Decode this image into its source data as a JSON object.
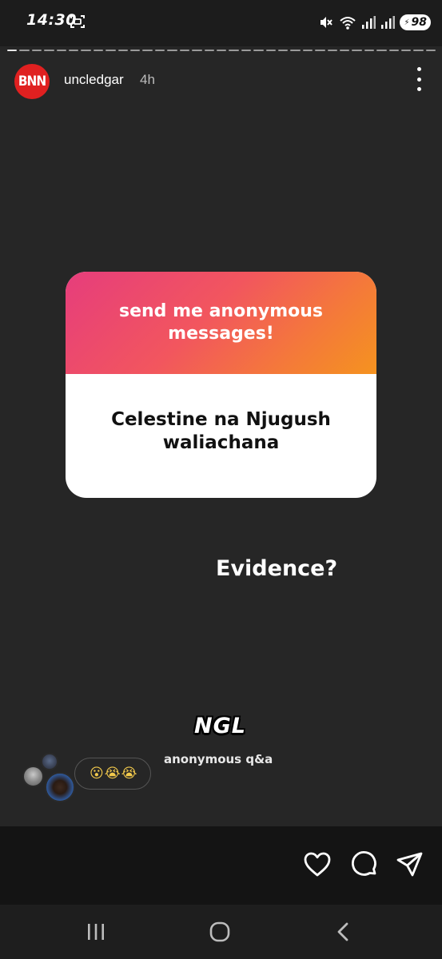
{
  "status_bar": {
    "time": "14:30",
    "battery": "98",
    "icons": [
      "screenshot-icon",
      "mute-icon",
      "wifi-icon",
      "signal-icon",
      "battery-icon"
    ]
  },
  "story": {
    "progress_segments": 35,
    "progress_done": 1
  },
  "header": {
    "avatar_text": "BNN",
    "username": "uncledgar",
    "time_ago": "4h",
    "icons": [
      "more-vertical-icon"
    ]
  },
  "question_card": {
    "prompt": "send me anonymous messages!",
    "message": "Celestine na Njugush waliachana"
  },
  "reply": {
    "text": "Evidence?"
  },
  "sticker": {
    "logo": "NGL",
    "caption": "anonymous q&a"
  },
  "viewers": {
    "reactions": "😮😭😭"
  },
  "actions": {
    "icons": [
      "heart-icon",
      "comment-icon",
      "send-icon"
    ]
  },
  "nav": {
    "icons": [
      "recent-apps-icon",
      "home-icon",
      "back-icon"
    ]
  },
  "colors": {
    "gradient_start": "#e63d7c",
    "gradient_end": "#f5931f",
    "avatar_red": "#e02020",
    "background": "#262626"
  }
}
